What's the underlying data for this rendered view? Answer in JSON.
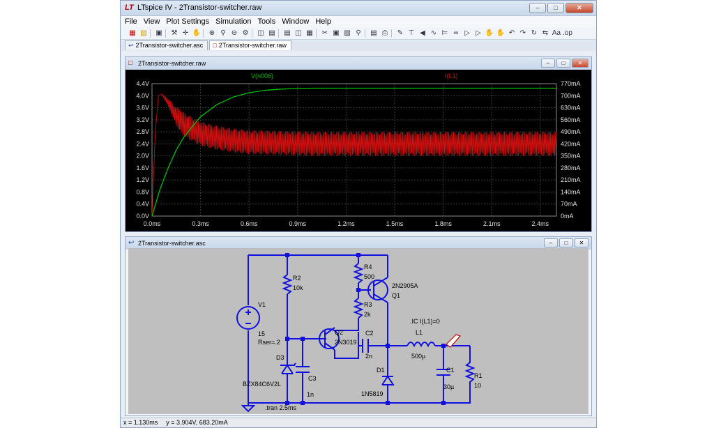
{
  "app": {
    "title": "LTspice IV - 2Transistor-switcher.raw",
    "logo": "LT"
  },
  "menu": [
    "File",
    "View",
    "Plot Settings",
    "Simulation",
    "Tools",
    "Window",
    "Help"
  ],
  "tabs": [
    {
      "label": "2Transistor-switcher.asc",
      "icon": "schematic-icon"
    },
    {
      "label": "2Transistor-switcher.raw",
      "icon": "waveform-icon"
    }
  ],
  "plot_window": {
    "title": "2Transistor-switcher.raw"
  },
  "schematic_window": {
    "title": "2Transistor-switcher.asc"
  },
  "chart_data": {
    "type": "line",
    "background": "#000000",
    "xlabel": "",
    "x_ticks": [
      "0.0ms",
      "0.3ms",
      "0.6ms",
      "0.9ms",
      "1.2ms",
      "1.5ms",
      "1.8ms",
      "2.1ms",
      "2.4ms"
    ],
    "xlim": [
      0,
      2.5
    ],
    "y_left_ticks": [
      "0.0V",
      "0.4V",
      "0.8V",
      "1.2V",
      "1.6V",
      "2.0V",
      "2.4V",
      "2.8V",
      "3.2V",
      "3.6V",
      "4.0V",
      "4.4V"
    ],
    "y_left_lim": [
      0,
      4.4
    ],
    "y_right_ticks": [
      "0mA",
      "70mA",
      "140mA",
      "210mA",
      "280mA",
      "350mA",
      "420mA",
      "490mA",
      "560mA",
      "630mA",
      "700mA",
      "770mA"
    ],
    "y_right_lim": [
      0,
      770
    ],
    "series": [
      {
        "name": "V(n006)",
        "color": "#00c000",
        "axis": "left",
        "x": [
          0,
          0.05,
          0.1,
          0.15,
          0.2,
          0.3,
          0.4,
          0.5,
          0.6,
          0.7,
          0.8,
          0.9,
          1.0,
          1.2,
          1.5,
          2.0,
          2.5
        ],
        "y": [
          0,
          0.9,
          1.6,
          2.2,
          2.65,
          3.3,
          3.7,
          3.95,
          4.1,
          4.18,
          4.22,
          4.24,
          4.25,
          4.25,
          4.25,
          4.25,
          4.25
        ]
      },
      {
        "name": "I(L1)",
        "color": "#d01010",
        "axis": "right",
        "ripple_ma": [
          350,
          490
        ],
        "x": [
          0,
          0.02,
          0.04,
          0.06,
          0.1,
          0.15,
          0.2,
          0.3,
          0.4,
          0.5,
          0.6,
          0.8,
          1.0,
          1.5,
          2.0,
          2.5
        ],
        "y": [
          0,
          480,
          700,
          710,
          660,
          580,
          530,
          480,
          455,
          440,
          430,
          425,
          420,
          420,
          420,
          420
        ]
      }
    ]
  },
  "schematic": {
    "components": {
      "v1_name": "V1",
      "v1_value": "15",
      "v1_rser": "Rser=.2",
      "r2_name": "R2",
      "r2_value": "10k",
      "r4_name": "R4",
      "r4_value": "500",
      "r3_name": "R3",
      "r3_value": "2k",
      "q1_part": "2N2905A",
      "q1_name": "Q1",
      "q2_name": "Q2",
      "q2_part": "2N3019",
      "c2_name": "C2",
      "c2_value": "2n",
      "l1_name": "L1",
      "l1_value": "500µ",
      "ic_directive": ".IC I(L1)=0",
      "d3_name": "D3",
      "d3_part": "BZX84C6V2L",
      "c3_name": "C3",
      "c3_value": "1n",
      "d1_name": "D1",
      "d1_part": "1N5819",
      "c1_name": "C1",
      "c1_value": "30µ",
      "r1_name": "R1",
      "r1_value": "10",
      "tran": ".tran 2.5ms"
    }
  },
  "status": {
    "x": "x = 1.130ms",
    "y": "y = 3.904V, 683.20mA"
  }
}
